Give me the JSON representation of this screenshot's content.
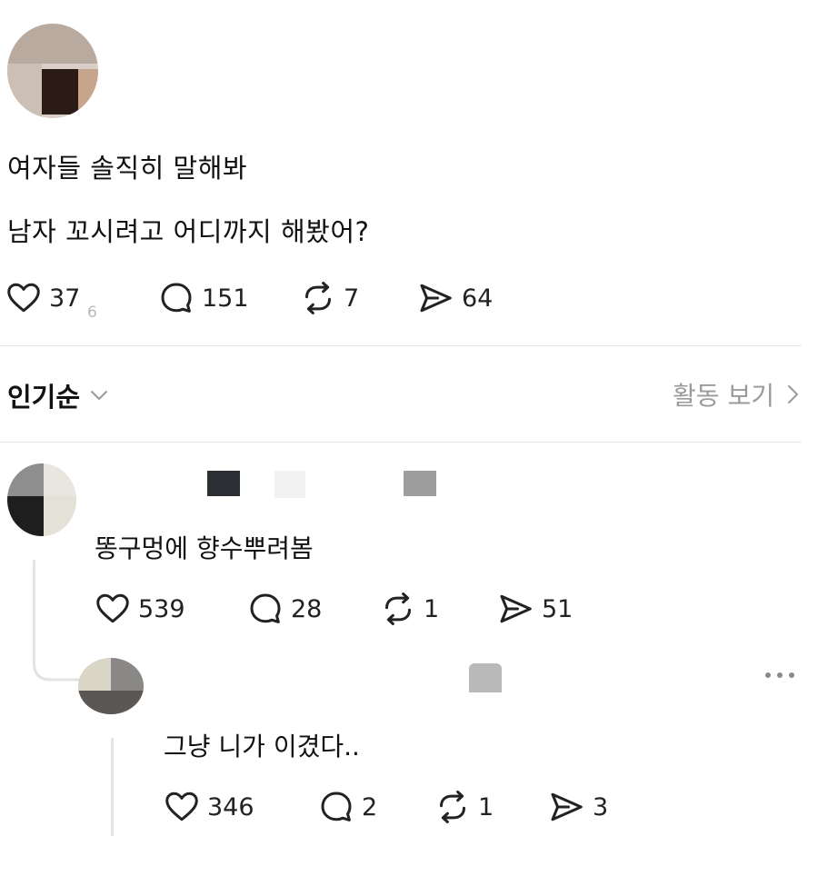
{
  "post": {
    "line1": "여자들 솔직히 말해봐",
    "line2": "남자 꼬시려고 어디까지 해봤어?",
    "likes": "37",
    "likes_overlay": "6",
    "replies": "151",
    "reposts": "7",
    "shares": "64"
  },
  "sort": {
    "label": "인기순",
    "activity_label": "활동 보기"
  },
  "reply1": {
    "text": "똥구멍에 향수뿌려봄",
    "likes": "539",
    "replies": "28",
    "reposts": "1",
    "shares": "51"
  },
  "reply2": {
    "text": "그냥 니가 이겼다..",
    "likes": "346",
    "replies": "2",
    "reposts": "1",
    "shares": "3"
  },
  "icons": {
    "like": "heart-icon",
    "reply": "speech-bubble-icon",
    "repost": "repost-icon",
    "share": "send-icon",
    "more": "more-dots-icon",
    "chevron": "chevron-icon"
  }
}
